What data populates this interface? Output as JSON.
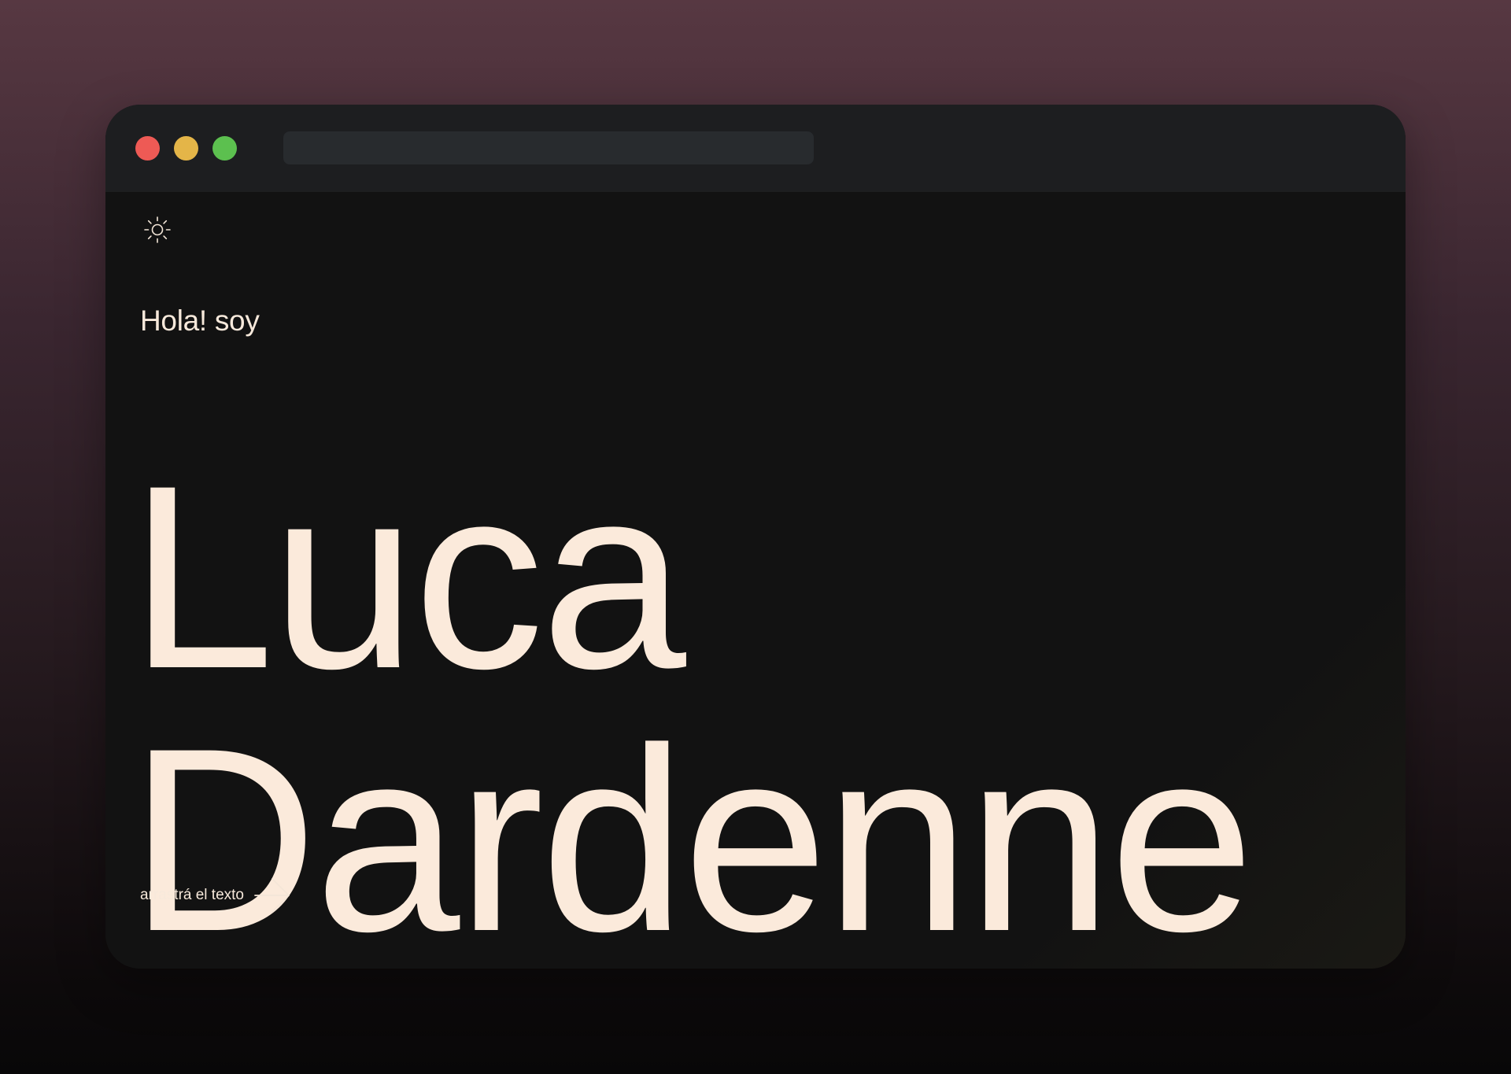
{
  "window": {
    "traffic_lights": {
      "close_color": "#ee5a55",
      "minimize_color": "#e4b548",
      "maximize_color": "#5cc04f"
    },
    "address_bar": {
      "value": ""
    }
  },
  "content": {
    "theme_toggle_icon": "sun-icon",
    "greeting": "Hola! soy",
    "name_line_1": "Luca",
    "name_line_2": "Dardenne",
    "drag_hint": {
      "label": "arrastrá el texto",
      "icon": "arrow-right-icon"
    }
  },
  "colors": {
    "text_cream": "#fbeadb",
    "window_bg": "#121212",
    "titlebar_bg": "#1d1e20"
  }
}
